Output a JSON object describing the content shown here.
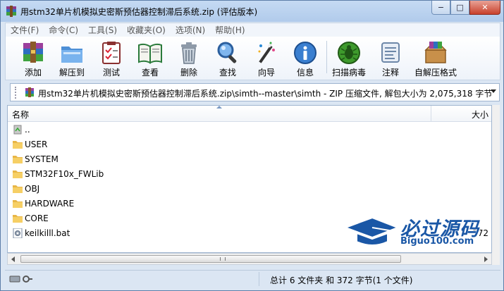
{
  "window": {
    "title": "用stm32单片机模拟史密斯预估器控制滞后系统.zip (评估版本)",
    "controls": {
      "minimize": "−",
      "maximize": "□",
      "close": "✕"
    }
  },
  "menu": [
    {
      "label": "文件(F)"
    },
    {
      "label": "命令(C)"
    },
    {
      "label": "工具(S)"
    },
    {
      "label": "收藏夹(O)"
    },
    {
      "label": "选项(N)"
    },
    {
      "label": "帮助(H)"
    }
  ],
  "toolbar": [
    {
      "label": "添加",
      "icon": "add-archive-icon"
    },
    {
      "label": "解压到",
      "icon": "extract-to-icon"
    },
    {
      "label": "测试",
      "icon": "test-archive-icon"
    },
    {
      "label": "查看",
      "icon": "view-book-icon"
    },
    {
      "label": "删除",
      "icon": "trash-icon"
    },
    {
      "label": "查找",
      "icon": "magnifier-icon"
    },
    {
      "label": "向导",
      "icon": "wizard-wand-icon"
    },
    {
      "label": "信息",
      "icon": "info-icon"
    },
    {
      "label": "扫描病毒",
      "icon": "virus-scan-icon"
    },
    {
      "label": "注释",
      "icon": "comment-icon"
    },
    {
      "label": "自解压格式",
      "icon": "sfx-box-icon"
    }
  ],
  "address": {
    "path": "用stm32单片机模拟史密斯预估器控制滞后系统.zip\\simth--master\\simth - ZIP 压缩文件, 解包大小为 2,075,318 字节"
  },
  "columns": {
    "name": "名称",
    "size": "大小"
  },
  "files": [
    {
      "name": "..",
      "type": "up",
      "size": ""
    },
    {
      "name": "USER",
      "type": "folder",
      "size": ""
    },
    {
      "name": "SYSTEM",
      "type": "folder",
      "size": ""
    },
    {
      "name": "STM32F10x_FWLib",
      "type": "folder",
      "size": ""
    },
    {
      "name": "OBJ",
      "type": "folder",
      "size": ""
    },
    {
      "name": "HARDWARE",
      "type": "folder",
      "size": ""
    },
    {
      "name": "CORE",
      "type": "folder",
      "size": ""
    },
    {
      "name": "keilkilll.bat",
      "type": "bat",
      "size": "372"
    }
  ],
  "status": {
    "text": "总计 6 文件夹 和 372 字节(1 个文件)"
  },
  "watermark": {
    "cn": "必过源码",
    "en": "Biguo100.com"
  }
}
